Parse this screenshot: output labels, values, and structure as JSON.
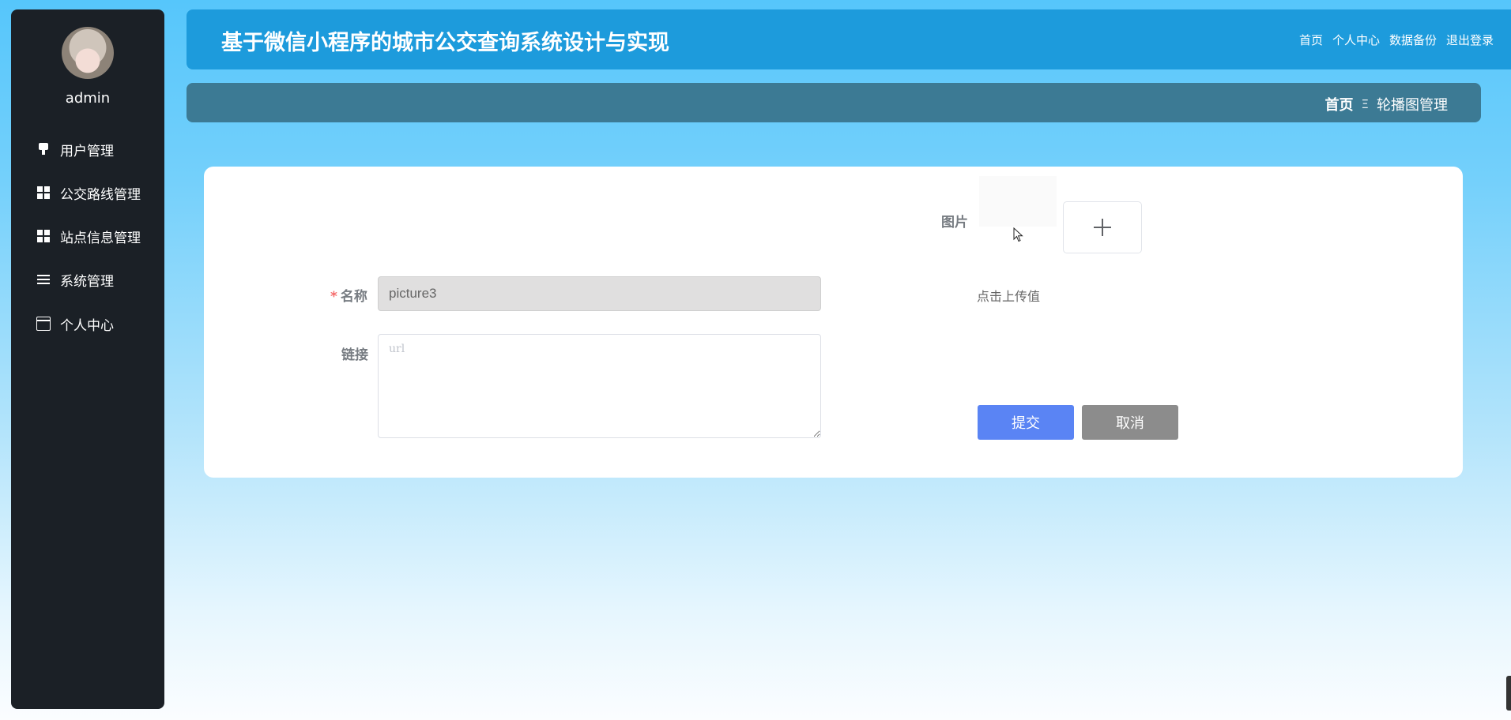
{
  "user": {
    "name": "admin"
  },
  "sidebar": {
    "items": [
      {
        "label": "用户管理",
        "icon": "user-icon"
      },
      {
        "label": "公交路线管理",
        "icon": "grid-icon"
      },
      {
        "label": "站点信息管理",
        "icon": "grid-icon"
      },
      {
        "label": "系统管理",
        "icon": "list-icon"
      },
      {
        "label": "个人中心",
        "icon": "card-icon"
      }
    ]
  },
  "header": {
    "title": "基于微信小程序的城市公交查询系统设计与实现",
    "links": [
      "首页",
      "个人中心",
      "数据备份",
      "退出登录"
    ]
  },
  "breadcrumb": {
    "home": "首页",
    "separator": "Ξ",
    "current": "轮播图管理"
  },
  "form": {
    "name_label": "名称",
    "required_mark": "*",
    "name_value": "picture3",
    "link_label": "链接",
    "link_placeholder": "url",
    "image_label": "图片",
    "upload_hint": "点击上传值",
    "submit_label": "提交",
    "cancel_label": "取消"
  },
  "colors": {
    "sidebar_bg": "#1b2026",
    "header_bg": "#1d9bdc",
    "breadcrumb_bg": "#3c7a94",
    "submit_bg": "#5a84f4",
    "cancel_bg": "#8c8c8c"
  }
}
